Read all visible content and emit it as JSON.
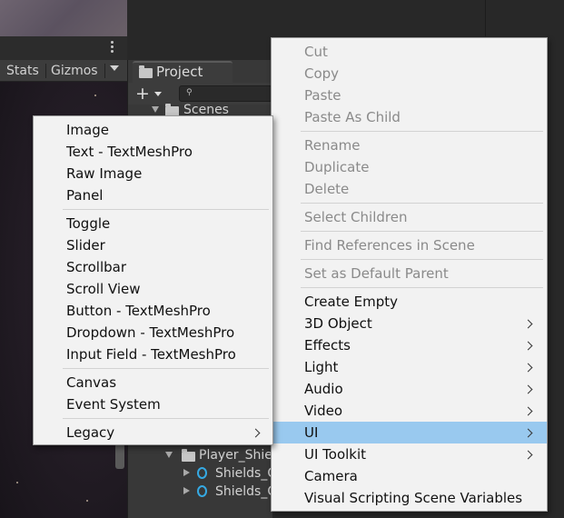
{
  "scene_toolbar": {
    "stats_label": "Stats",
    "gizmos_label": "Gizmos"
  },
  "project_panel": {
    "tab_label": "Project",
    "tree": [
      {
        "label": "Scenes"
      },
      {
        "label": "Player_Shie"
      },
      {
        "label": "Shields_C"
      },
      {
        "label": "Shields_C"
      }
    ]
  },
  "hierarchy_menu": {
    "items": [
      {
        "label": "Cut",
        "enabled": false
      },
      {
        "label": "Copy",
        "enabled": false
      },
      {
        "label": "Paste",
        "enabled": false
      },
      {
        "label": "Paste As Child",
        "enabled": false
      },
      {
        "label": "Rename",
        "enabled": false
      },
      {
        "label": "Duplicate",
        "enabled": false
      },
      {
        "label": "Delete",
        "enabled": false
      },
      {
        "label": "Select Children",
        "enabled": false
      },
      {
        "label": "Find References in Scene",
        "enabled": false
      },
      {
        "label": "Set as Default Parent",
        "enabled": false
      },
      {
        "label": "Create Empty",
        "enabled": true
      },
      {
        "label": "3D Object",
        "enabled": true,
        "submenu": true
      },
      {
        "label": "Effects",
        "enabled": true,
        "submenu": true
      },
      {
        "label": "Light",
        "enabled": true,
        "submenu": true
      },
      {
        "label": "Audio",
        "enabled": true,
        "submenu": true
      },
      {
        "label": "Video",
        "enabled": true,
        "submenu": true
      },
      {
        "label": "UI",
        "enabled": true,
        "submenu": true,
        "highlighted": true
      },
      {
        "label": "UI Toolkit",
        "enabled": true,
        "submenu": true
      },
      {
        "label": "Camera",
        "enabled": true
      },
      {
        "label": "Visual Scripting Scene Variables",
        "enabled": true
      }
    ]
  },
  "ui_submenu": {
    "items": [
      {
        "label": "Image"
      },
      {
        "label": "Text - TextMeshPro"
      },
      {
        "label": "Raw Image"
      },
      {
        "label": "Panel"
      },
      {
        "label": "Toggle"
      },
      {
        "label": "Slider"
      },
      {
        "label": "Scrollbar"
      },
      {
        "label": "Scroll View"
      },
      {
        "label": "Button - TextMeshPro"
      },
      {
        "label": "Dropdown - TextMeshPro"
      },
      {
        "label": "Input Field - TextMeshPro"
      },
      {
        "label": "Canvas"
      },
      {
        "label": "Event System"
      },
      {
        "label": "Legacy",
        "submenu": true
      }
    ]
  },
  "colors": {
    "menu_background": "#f2f2f2",
    "highlight": "#99c9ef",
    "disabled_text": "#8a8a8a",
    "editor_dark": "#282828",
    "prefab_blue": "#35a9e3"
  }
}
